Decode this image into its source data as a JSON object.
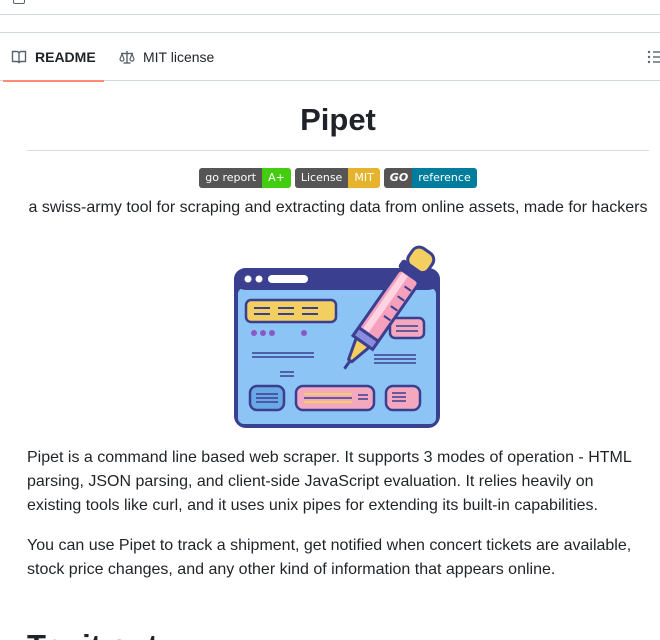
{
  "tabs": {
    "readme_label": "README",
    "license_label": "MIT license"
  },
  "readme": {
    "title": "Pipet",
    "badges": [
      {
        "left": "go report",
        "right": "A+",
        "right_color": "#44cc11"
      },
      {
        "left": "License",
        "right": "MIT",
        "right_color": "#e6b32c"
      },
      {
        "left": "GO",
        "right": "reference",
        "right_color": "#007d9c"
      }
    ],
    "tagline": "a swiss-army tool for scraping and extracting data from online assets, made for hackers",
    "paragraph_1": "Pipet is a command line based web scraper. It supports 3 modes of operation - HTML parsing, JSON parsing, and client-side JavaScript evaluation. It relies heavily on existing tools like curl, and it uses unix pipes for extending its built-in capabilities.",
    "paragraph_2": "You can use Pipet to track a shipment, get notified when concert tickets are available, stock price changes, and any other kind of information that appears online.",
    "next_heading": "Try it out"
  },
  "colors": {
    "active_tab_underline": "#fd8c73",
    "border": "#d0d7de",
    "text": "#1f2328",
    "muted": "#59636e"
  }
}
